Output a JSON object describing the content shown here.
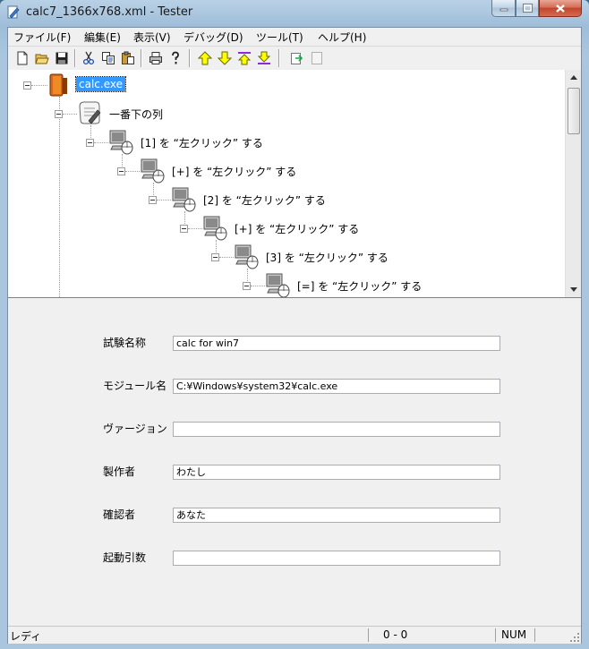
{
  "window": {
    "title": "calc7_1366x768.xml - Tester"
  },
  "menu": [
    {
      "label": "ファイル(F)"
    },
    {
      "label": "編集(E)"
    },
    {
      "label": "表示(V)"
    },
    {
      "label": "デバッグ(D)"
    },
    {
      "label": "ツール(T)"
    },
    {
      "label": "ヘルプ(H)"
    }
  ],
  "toolbar": {
    "buttons": [
      {
        "icon": "new-file-icon"
      },
      {
        "icon": "open-folder-icon"
      },
      {
        "icon": "save-icon"
      },
      {
        "icon": "cut-icon"
      },
      {
        "icon": "copy-icon"
      },
      {
        "icon": "paste-icon"
      },
      {
        "icon": "print-icon"
      },
      {
        "icon": "help-icon"
      },
      {
        "icon": "move-up-icon"
      },
      {
        "icon": "move-down-icon"
      },
      {
        "icon": "move-top-icon"
      },
      {
        "icon": "move-bottom-icon"
      },
      {
        "icon": "run-icon"
      },
      {
        "icon": "stop-icon"
      }
    ]
  },
  "tree": {
    "root": {
      "label": "calc.exe",
      "icon": "application-icon",
      "selected": true
    },
    "group": {
      "label": "一番下の列",
      "icon": "script-icon"
    },
    "steps": [
      {
        "label": "[1] を “左クリック” する",
        "icon": "mouse-click-icon"
      },
      {
        "label": "[+] を “左クリック” する",
        "icon": "mouse-click-icon"
      },
      {
        "label": "[2] を “左クリック” する",
        "icon": "mouse-click-icon"
      },
      {
        "label": "[+] を “左クリック” する",
        "icon": "mouse-click-icon"
      },
      {
        "label": "[3] を “左クリック” する",
        "icon": "mouse-click-icon"
      },
      {
        "label": "[=] を “左クリック” する",
        "icon": "mouse-click-icon"
      }
    ]
  },
  "properties": {
    "test_name": {
      "label": "試験名称",
      "value": "calc for win7"
    },
    "module_name": {
      "label": "モジュール名",
      "value": "C:¥Windows¥system32¥calc.exe"
    },
    "version": {
      "label": "ヴァージョン",
      "value": ""
    },
    "author": {
      "label": "製作者",
      "value": "わたし"
    },
    "reviewer": {
      "label": "確認者",
      "value": "あなた"
    },
    "arguments": {
      "label": "起動引数",
      "value": ""
    }
  },
  "status": {
    "message": "レディ",
    "position": "0 -    0",
    "numlock": "NUM"
  },
  "colors": {
    "selection": "#3399ff",
    "window_frame": "#a9c6de",
    "close_button": "#c2452c"
  }
}
